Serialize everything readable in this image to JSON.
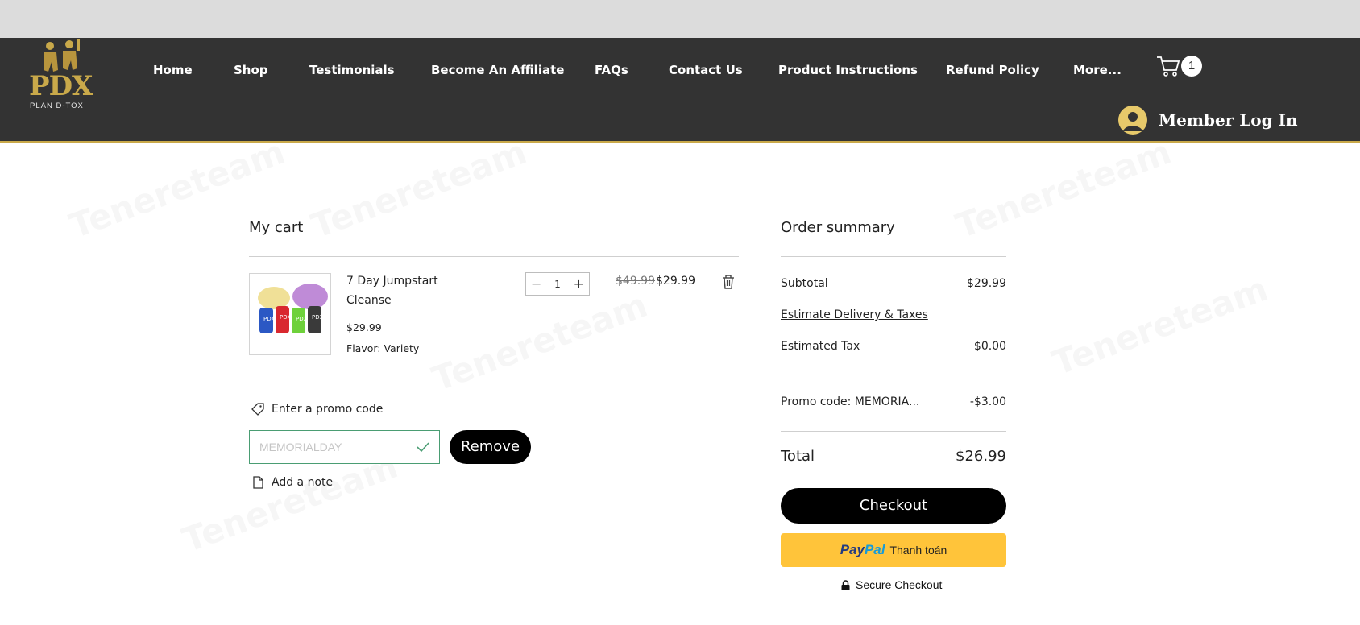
{
  "header": {
    "logo_text": "PDX",
    "logo_subtitle": "PLAN D-TOX",
    "nav": [
      {
        "label": "Home"
      },
      {
        "label": "Shop"
      },
      {
        "label": "Testimonials"
      },
      {
        "label": "Become An Affiliate"
      },
      {
        "label": "FAQs"
      },
      {
        "label": "Contact Us"
      },
      {
        "label": "Product Instructions"
      },
      {
        "label": "Refund Policy"
      },
      {
        "label": "More..."
      }
    ],
    "cart_count": "1",
    "member_label": "Member Log In"
  },
  "cart": {
    "title": "My cart",
    "items": [
      {
        "name_line1": "7 Day Jumpstart",
        "name_line2": "Cleanse",
        "price": "$29.99",
        "option": "Flavor: Variety",
        "quantity": "1",
        "original_price": "$49.99",
        "sale_price": "$29.99"
      }
    ],
    "promo_label": "Enter a promo code",
    "promo_value": "MEMORIALDAY",
    "remove_label": "Remove",
    "note_label": "Add a note"
  },
  "summary": {
    "title": "Order summary",
    "subtotal_label": "Subtotal",
    "subtotal_value": "$29.99",
    "estimate_link": "Estimate Delivery & Taxes",
    "tax_label": "Estimated Tax",
    "tax_value": "$0.00",
    "promo_label": "Promo code: MEMORIA...",
    "promo_value": "-$3.00",
    "total_label": "Total",
    "total_value": "$26.99",
    "checkout_label": "Checkout",
    "paypal_brand_1": "Pay",
    "paypal_brand_2": "Pal",
    "paypal_label": "Thanh toán",
    "secure_label": "Secure Checkout"
  },
  "colors": {
    "header_bg": "#333333",
    "accent_gold": "#c9a94a",
    "paypal_yellow": "#ffc43a",
    "promo_border": "#4a9d73"
  }
}
